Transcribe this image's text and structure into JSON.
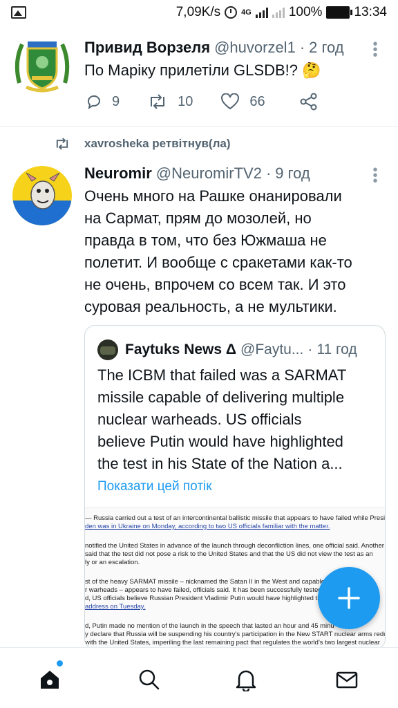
{
  "status_bar": {
    "net_speed": "7,09K/s",
    "network_type": "4G",
    "battery": "100%",
    "time": "13:34",
    "icons": [
      "image-icon",
      "alarm-icon",
      "signal-icon",
      "battery-icon"
    ]
  },
  "tweet1": {
    "name": "Привид Ворзеля",
    "handle": "@huvorzel1",
    "dot": "·",
    "time": "2 год",
    "text": "По Маріку прилетіли GLSDB!? 🤔",
    "replies": "9",
    "retweets": "10",
    "likes": "66"
  },
  "retweet_banner": {
    "text": "xavrosheka ретвітнув(ла)"
  },
  "tweet2": {
    "name": "Neuromir",
    "handle": "@NeuromirTV2",
    "dot": "·",
    "time": "9 год",
    "lines": [
      "Очень много на Рашке онанировали",
      "на Сармат, прям до мозолей, но",
      "правда в том, что без Южмаша не",
      "полетит. И вообще с сракетами как-то",
      "не очень, впрочем со всем так. И это",
      "суровая реальность, а не мультики."
    ]
  },
  "quote": {
    "name": "Faytuks News Δ",
    "handle": "@Faytu...",
    "dot": "·",
    "time": "11 год",
    "lines": [
      "The ICBM that failed was a SARMAT",
      "missile capable of delivering multiple",
      "nuclear warheads. US officials",
      "believe Putin would have highlighted",
      "the test in his State of the Nation a..."
    ],
    "show_thread": "Показати цей потік",
    "image_lines": [
      "— Russia carried out a test of an intercontinental ballistic missile that appears to have failed while Preside",
      "den was in Ukraine on Monday, according to two US officials familiar with the matter.",
      "",
      " notified the United States in advance of the launch through deconfliction lines, one official said. Another",
      " said that the test did not pose a risk to the United States and that the US did not view the test as an",
      "ly or an escalation.",
      "",
      "st of the heavy SARMAT missile – nicknamed the Satan II in the West and capable of d",
      "r warheads – appears to have failed, officials said. It has been successfully tested b",
      "d, US officials believe Russian President Vladimir Putin would have highlighted the",
      " address on Tuesday.",
      "",
      "d, Putin made no mention of the launch in the speech that lasted an hour and 45 minu",
      "y declare that Russia will be suspending his country's participation in the New START nuclear arms reduc",
      "with the United States, imperiling the last remaining pact that regulates the world's two largest nuclear"
    ]
  },
  "accent_color": "#1d9bf0",
  "bottom_nav": [
    "home-icon",
    "search-icon",
    "notifications-icon",
    "messages-icon"
  ]
}
